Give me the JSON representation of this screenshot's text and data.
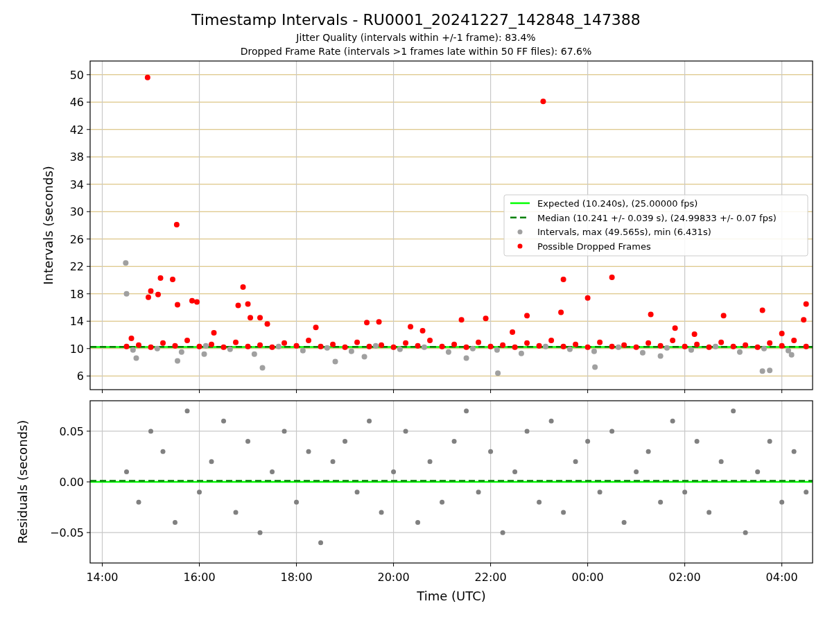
{
  "title": "Timestamp Intervals - RU0001_20241227_142848_147388",
  "subtitles": [
    "Jitter Quality (intervals within +/-1 frame): 83.4%",
    "Dropped Frame Rate (intervals >1 frames late within 50 FF files): 67.6%"
  ],
  "intervals_plot": {
    "chart_data": {
      "type": "scatter",
      "ylabel": "Intervals (seconds)",
      "grid": true,
      "legend": true,
      "xlim": [
        "2024-12-27 13:45",
        "2024-12-28 04:38"
      ],
      "ylim": [
        4,
        52
      ],
      "yticks": [
        {
          "value": 6,
          "label": "6"
        },
        {
          "value": 10,
          "label": "10"
        },
        {
          "value": 14,
          "label": "14"
        },
        {
          "value": 18,
          "label": "18"
        },
        {
          "value": 22,
          "label": "22"
        },
        {
          "value": 26,
          "label": "26"
        },
        {
          "value": 30,
          "label": "30"
        },
        {
          "value": 34,
          "label": "34"
        },
        {
          "value": 38,
          "label": "38"
        },
        {
          "value": 42,
          "label": "42"
        },
        {
          "value": 46,
          "label": "46"
        },
        {
          "value": 50,
          "label": "50"
        }
      ],
      "series": [
        {
          "name": "Expected (10.240s), (25.00000 fps)",
          "color": "#00ff00",
          "type": "line",
          "line_style": "solid",
          "x": [
            "2024-12-27 13:45",
            "2024-12-28 04:38"
          ],
          "values": [
            10.24,
            10.24
          ]
        },
        {
          "name": "Median (10.241 +/- 0.039 s), (24.99833 +/- 0.07 fps)",
          "color": "#008000",
          "type": "line",
          "line_style": "dashed",
          "x": [
            "2024-12-27 13:45",
            "2024-12-28 04:38"
          ],
          "values": [
            10.241,
            10.241
          ]
        },
        {
          "name": "Intervals, max (49.565s), min (6.431s)",
          "color": "#a0a0a0",
          "type": "scatter",
          "x": [
            "2024-12-27 14:38",
            "2024-12-27 15:08",
            "2024-12-27 15:38",
            "2024-12-27 16:08",
            "2024-12-27 16:38",
            "2024-12-27 17:08",
            "2024-12-27 17:38",
            "2024-12-27 18:08",
            "2024-12-27 18:38",
            "2024-12-27 19:08",
            "2024-12-27 19:38",
            "2024-12-27 20:08",
            "2024-12-27 20:38",
            "2024-12-27 21:08",
            "2024-12-27 21:38",
            "2024-12-27 22:08",
            "2024-12-27 22:38",
            "2024-12-27 23:08",
            "2024-12-27 23:38",
            "2024-12-28 00:08",
            "2024-12-28 00:38",
            "2024-12-28 01:08",
            "2024-12-28 01:38",
            "2024-12-28 02:08",
            "2024-12-28 02:38",
            "2024-12-28 03:08",
            "2024-12-28 03:38",
            "2024-12-28 04:08",
            "2024-12-27 14:29",
            "2024-12-27 14:30",
            "2024-12-27 14:42",
            "2024-12-27 15:33",
            "2024-12-27 17:18",
            "2024-12-27 18:48",
            "2024-12-27 22:09",
            "2024-12-28 00:09",
            "2024-12-28 03:36",
            "2024-12-28 03:45",
            "2024-12-28 04:12",
            "2024-12-27 19:24",
            "2024-12-27 21:30",
            "2024-12-28 01:30",
            "2024-12-27 16:06"
          ],
          "values": [
            9.8,
            10.0,
            9.5,
            10.4,
            9.9,
            9.2,
            10.3,
            9.7,
            10.1,
            9.6,
            10.4,
            9.9,
            10.2,
            9.5,
            10.0,
            9.8,
            9.3,
            10.3,
            9.9,
            9.6,
            10.2,
            9.4,
            10.1,
            9.8,
            10.3,
            9.5,
            10.0,
            9.7,
            22.5,
            18.0,
            8.6,
            8.2,
            7.2,
            8.1,
            6.4,
            7.3,
            6.7,
            6.8,
            9.1,
            8.8,
            8.6,
            8.9,
            9.2
          ]
        },
        {
          "name": "Possible Dropped Frames",
          "color": "#ff0000",
          "type": "scatter",
          "x": [
            "2024-12-27 14:30",
            "2024-12-27 14:45",
            "2024-12-27 15:00",
            "2024-12-27 15:15",
            "2024-12-27 15:30",
            "2024-12-27 15:45",
            "2024-12-27 16:00",
            "2024-12-27 16:15",
            "2024-12-27 16:30",
            "2024-12-27 16:45",
            "2024-12-27 17:00",
            "2024-12-27 17:15",
            "2024-12-27 17:30",
            "2024-12-27 17:45",
            "2024-12-27 18:00",
            "2024-12-27 18:15",
            "2024-12-27 18:30",
            "2024-12-27 18:45",
            "2024-12-27 19:00",
            "2024-12-27 19:15",
            "2024-12-27 19:30",
            "2024-12-27 19:45",
            "2024-12-27 20:00",
            "2024-12-27 20:15",
            "2024-12-27 20:30",
            "2024-12-27 20:45",
            "2024-12-27 21:00",
            "2024-12-27 21:15",
            "2024-12-27 21:30",
            "2024-12-27 21:45",
            "2024-12-27 22:00",
            "2024-12-27 22:15",
            "2024-12-27 22:30",
            "2024-12-27 22:45",
            "2024-12-27 23:00",
            "2024-12-27 23:15",
            "2024-12-27 23:30",
            "2024-12-27 23:45",
            "2024-12-28 00:00",
            "2024-12-28 00:15",
            "2024-12-28 00:30",
            "2024-12-28 00:45",
            "2024-12-28 01:00",
            "2024-12-28 01:15",
            "2024-12-28 01:30",
            "2024-12-28 01:45",
            "2024-12-28 02:00",
            "2024-12-28 02:15",
            "2024-12-28 02:30",
            "2024-12-28 02:45",
            "2024-12-28 03:00",
            "2024-12-28 03:15",
            "2024-12-28 03:30",
            "2024-12-28 03:45",
            "2024-12-28 04:00",
            "2024-12-28 04:15",
            "2024-12-28 04:30",
            "2024-12-27 14:56",
            "2024-12-27 15:32",
            "2024-12-27 15:12",
            "2024-12-27 15:27",
            "2024-12-27 15:00",
            "2024-12-27 14:57",
            "2024-12-27 15:09",
            "2024-12-27 15:33",
            "2024-12-27 15:51",
            "2024-12-27 15:57",
            "2024-12-27 16:54",
            "2024-12-27 17:00",
            "2024-12-27 17:03",
            "2024-12-27 17:15",
            "2024-12-27 16:48",
            "2024-12-27 17:24",
            "2024-12-27 18:24",
            "2024-12-27 19:27",
            "2024-12-27 19:42",
            "2024-12-27 20:21",
            "2024-12-27 21:24",
            "2024-12-27 21:54",
            "2024-12-27 22:27",
            "2024-12-27 22:45",
            "2024-12-27 23:05",
            "2024-12-27 23:30",
            "2024-12-27 23:27",
            "2024-12-28 00:00",
            "2024-12-28 00:30",
            "2024-12-28 01:18",
            "2024-12-28 01:48",
            "2024-12-28 02:48",
            "2024-12-28 03:36",
            "2024-12-28 04:30",
            "2024-12-28 04:27",
            "2024-12-28 04:00",
            "2024-12-27 14:36",
            "2024-12-27 16:18",
            "2024-12-27 20:36",
            "2024-12-28 02:12"
          ],
          "values": [
            10.3,
            10.5,
            10.2,
            10.8,
            10.4,
            11.2,
            10.3,
            10.6,
            10.2,
            10.9,
            10.3,
            10.5,
            10.2,
            10.8,
            10.4,
            11.2,
            10.3,
            10.6,
            10.2,
            10.9,
            10.3,
            10.5,
            10.2,
            10.8,
            10.4,
            11.2,
            10.3,
            10.6,
            10.2,
            10.9,
            10.3,
            10.5,
            10.2,
            10.8,
            10.4,
            11.2,
            10.3,
            10.6,
            10.2,
            10.9,
            10.3,
            10.5,
            10.2,
            10.8,
            10.4,
            11.2,
            10.3,
            10.6,
            10.2,
            10.9,
            10.3,
            10.5,
            10.2,
            10.8,
            10.4,
            11.2,
            10.3,
            49.6,
            28.1,
            20.3,
            20.1,
            18.4,
            17.5,
            17.9,
            16.4,
            17.0,
            16.8,
            19.0,
            16.5,
            14.5,
            14.5,
            16.3,
            13.6,
            13.1,
            13.8,
            13.9,
            13.2,
            14.2,
            14.4,
            12.4,
            14.8,
            46.1,
            20.1,
            15.3,
            17.4,
            20.4,
            15.0,
            13.0,
            14.8,
            15.6,
            16.5,
            14.2,
            12.2,
            11.5,
            12.3,
            12.6,
            12.1
          ]
        }
      ]
    }
  },
  "residuals_plot": {
    "chart_data": {
      "type": "scatter",
      "xlabel": "Time (UTC)",
      "ylabel": "Residuals (seconds)",
      "grid": true,
      "xlim": [
        "2024-12-27 13:45",
        "2024-12-28 04:38"
      ],
      "ylim": [
        -0.08,
        0.08
      ],
      "xticks": [
        {
          "value": "2024-12-27 14:00",
          "label": "14:00"
        },
        {
          "value": "2024-12-27 16:00",
          "label": "16:00"
        },
        {
          "value": "2024-12-27 18:00",
          "label": "18:00"
        },
        {
          "value": "2024-12-27 20:00",
          "label": "20:00"
        },
        {
          "value": "2024-12-27 22:00",
          "label": "22:00"
        },
        {
          "value": "2024-12-28 00:00",
          "label": "00:00"
        },
        {
          "value": "2024-12-28 02:00",
          "label": "02:00"
        },
        {
          "value": "2024-12-28 04:00",
          "label": "04:00"
        }
      ],
      "yticks": [
        {
          "value": -0.05,
          "label": "−0.05"
        },
        {
          "value": 0,
          "label": "0.00"
        },
        {
          "value": 0.05,
          "label": "0.05"
        }
      ],
      "series": [
        {
          "color": "#00ff00",
          "type": "line",
          "line_style": "solid",
          "x": [
            "2024-12-27 13:45",
            "2024-12-28 04:38"
          ],
          "values": [
            0,
            0
          ]
        },
        {
          "color": "#008000",
          "type": "line",
          "line_style": "dashed",
          "x": [
            "2024-12-27 13:45",
            "2024-12-28 04:38"
          ],
          "values": [
            0.001,
            0.001
          ]
        },
        {
          "color": "#808080",
          "type": "scatter",
          "x": [
            "2024-12-27 14:30",
            "2024-12-27 14:45",
            "2024-12-27 15:00",
            "2024-12-27 15:15",
            "2024-12-27 15:30",
            "2024-12-27 15:45",
            "2024-12-27 16:00",
            "2024-12-27 16:15",
            "2024-12-27 16:30",
            "2024-12-27 16:45",
            "2024-12-27 17:00",
            "2024-12-27 17:15",
            "2024-12-27 17:30",
            "2024-12-27 17:45",
            "2024-12-27 18:00",
            "2024-12-27 18:15",
            "2024-12-27 18:30",
            "2024-12-27 18:45",
            "2024-12-27 19:00",
            "2024-12-27 19:15",
            "2024-12-27 19:30",
            "2024-12-27 19:45",
            "2024-12-27 20:00",
            "2024-12-27 20:15",
            "2024-12-27 20:30",
            "2024-12-27 20:45",
            "2024-12-27 21:00",
            "2024-12-27 21:15",
            "2024-12-27 21:30",
            "2024-12-27 21:45",
            "2024-12-27 22:00",
            "2024-12-27 22:15",
            "2024-12-27 22:30",
            "2024-12-27 22:45",
            "2024-12-27 23:00",
            "2024-12-27 23:15",
            "2024-12-27 23:30",
            "2024-12-27 23:45",
            "2024-12-28 00:00",
            "2024-12-28 00:15",
            "2024-12-28 00:30",
            "2024-12-28 00:45",
            "2024-12-28 01:00",
            "2024-12-28 01:15",
            "2024-12-28 01:30",
            "2024-12-28 01:45",
            "2024-12-28 02:00",
            "2024-12-28 02:15",
            "2024-12-28 02:30",
            "2024-12-28 02:45",
            "2024-12-28 03:00",
            "2024-12-28 03:15",
            "2024-12-28 03:30",
            "2024-12-28 03:45",
            "2024-12-28 04:00",
            "2024-12-28 04:15",
            "2024-12-28 04:30"
          ],
          "values": [
            0.01,
            -0.02,
            0.05,
            0.03,
            -0.04,
            0.07,
            -0.01,
            0.02,
            0.06,
            -0.03,
            0.04,
            -0.05,
            0.01,
            0.05,
            -0.02,
            0.03,
            -0.06,
            0.02,
            0.04,
            -0.01,
            0.06,
            -0.03,
            0.01,
            0.05,
            -0.04,
            0.02,
            -0.02,
            0.04,
            0.07,
            -0.01,
            0.03,
            -0.05,
            0.01,
            0.05,
            -0.02,
            0.06,
            -0.03,
            0.02,
            0.04,
            -0.01,
            0.05,
            -0.04,
            0.01,
            0.03,
            -0.02,
            0.06,
            -0.01,
            0.04,
            -0.03,
            0.02,
            0.07,
            -0.05,
            0.01,
            0.04,
            -0.02,
            0.03,
            -0.01
          ]
        }
      ]
    }
  }
}
